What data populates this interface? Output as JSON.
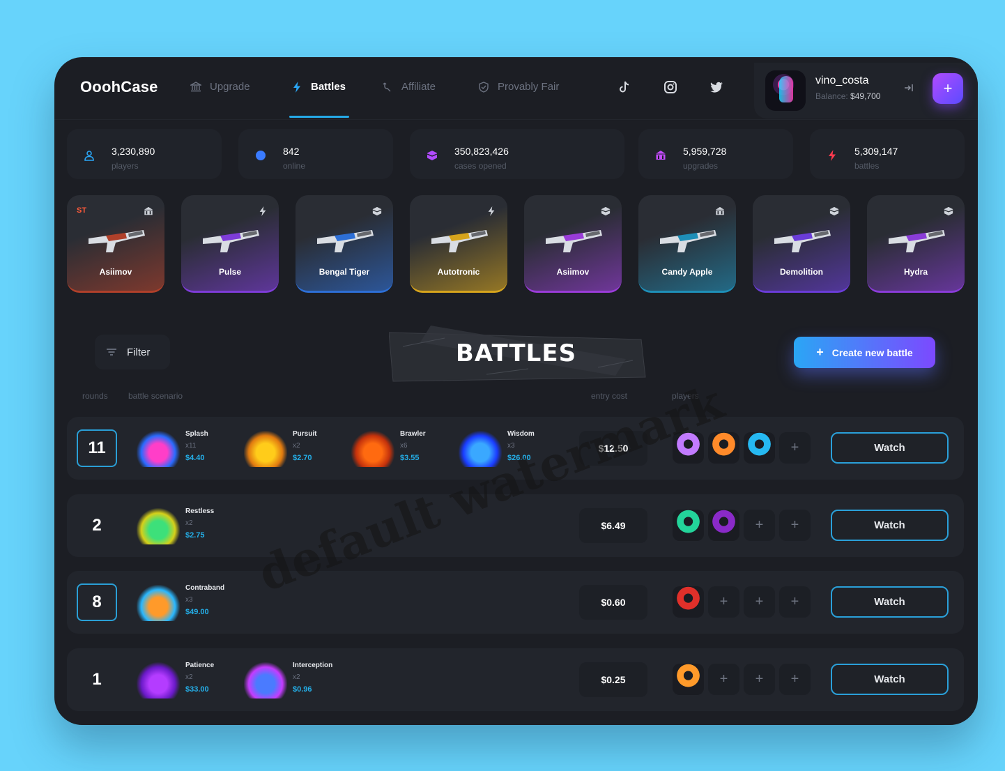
{
  "header": {
    "logo": "OoohCase",
    "nav": [
      {
        "label": "Upgrade",
        "icon": "bank-icon",
        "active": false
      },
      {
        "label": "Battles",
        "icon": "lightning-icon",
        "active": true
      },
      {
        "label": "Affiliate",
        "icon": "affiliate-icon",
        "active": false
      },
      {
        "label": "Provably Fair",
        "icon": "shield-check-icon",
        "active": false
      }
    ],
    "social": [
      "tiktok-icon",
      "instagram-icon",
      "twitter-icon"
    ],
    "user": {
      "name": "vino_costa",
      "balance_label": "Balance:",
      "balance_value": "$49,700"
    },
    "plus_button": "+"
  },
  "stats": [
    {
      "value": "3,230,890",
      "label": "players",
      "icon": "user-icon",
      "color": "#2aa6f5"
    },
    {
      "value": "842",
      "label": "online",
      "icon": "dot-icon",
      "color": "#3a7bff"
    },
    {
      "value": "350,823,426",
      "label": "cases opened",
      "icon": "case-icon",
      "color": "#b14bff"
    },
    {
      "value": "5,959,728",
      "label": "upgrades",
      "icon": "bank-icon",
      "color": "#c44bff"
    },
    {
      "value": "5,309,147",
      "label": "battles",
      "icon": "lightning-icon",
      "color": "#ff3a4e"
    }
  ],
  "skins": [
    {
      "name": "Asiimov",
      "badge": "ST",
      "icon": "bank-icon",
      "grad": [
        "#2a2d34",
        "#b0402a"
      ]
    },
    {
      "name": "Pulse",
      "badge": "",
      "icon": "lightning-icon",
      "grad": [
        "#2a2d34",
        "#7e3cd8"
      ]
    },
    {
      "name": "Bengal Tiger",
      "badge": "",
      "icon": "case-icon",
      "grad": [
        "#2a2d34",
        "#2d6fd6"
      ]
    },
    {
      "name": "Autotronic",
      "badge": "",
      "icon": "lightning-icon",
      "grad": [
        "#2a2d34",
        "#d6a41c"
      ]
    },
    {
      "name": "Asiimov",
      "badge": "",
      "icon": "case-icon",
      "grad": [
        "#2a2d34",
        "#9a3cd8"
      ]
    },
    {
      "name": "Candy Apple",
      "badge": "",
      "icon": "bank-icon",
      "grad": [
        "#2a2d34",
        "#1e8fb8"
      ]
    },
    {
      "name": "Demolition",
      "badge": "",
      "icon": "case-icon",
      "grad": [
        "#2a2d34",
        "#6a3cd8"
      ]
    },
    {
      "name": "Hydra",
      "badge": "",
      "icon": "case-icon",
      "grad": [
        "#2a2d34",
        "#8a3cd8"
      ]
    }
  ],
  "toolbar": {
    "filter_label": "Filter",
    "title": "BATTLES",
    "create_label": "Create new battle"
  },
  "columns": {
    "rounds": "rounds",
    "scenario": "battle scenario",
    "entry": "entry cost",
    "players": "players"
  },
  "battles": [
    {
      "rounds": "11",
      "boxed": true,
      "entry": "$12.50",
      "cases": [
        {
          "name": "Splash",
          "mult": "x11",
          "price": "$4.40",
          "colors": [
            "#ff3ec8",
            "#2a6bff"
          ]
        },
        {
          "name": "Pursuit",
          "mult": "x2",
          "price": "$2.70",
          "colors": [
            "#ffcc1a",
            "#e07a10"
          ]
        },
        {
          "name": "Brawler",
          "mult": "x6",
          "price": "$3.55",
          "colors": [
            "#ff6a10",
            "#c4320c"
          ]
        },
        {
          "name": "Wisdom",
          "mult": "x3",
          "price": "$26.00",
          "colors": [
            "#3aa8ff",
            "#1a3cff"
          ]
        }
      ],
      "players": [
        "#c27bff",
        "#ff8a2a",
        "#26b9f2"
      ],
      "empty_slots": 1,
      "watch": "Watch"
    },
    {
      "rounds": "2",
      "boxed": false,
      "entry": "$6.49",
      "cases": [
        {
          "name": "Restless",
          "mult": "x2",
          "price": "$2.75",
          "colors": [
            "#3de07a",
            "#d6d01a"
          ]
        }
      ],
      "players": [
        "#23d49a",
        "#8a2ac8"
      ],
      "empty_slots": 2,
      "watch": "Watch"
    },
    {
      "rounds": "8",
      "boxed": true,
      "entry": "$0.60",
      "cases": [
        {
          "name": "Contraband",
          "mult": "x3",
          "price": "$49.00",
          "colors": [
            "#ff9a2a",
            "#2ab8ff"
          ]
        }
      ],
      "players": [
        "#e0302a"
      ],
      "empty_slots": 3,
      "watch": "Watch"
    },
    {
      "rounds": "1",
      "boxed": false,
      "entry": "$0.25",
      "cases": [
        {
          "name": "Patience",
          "mult": "x2",
          "price": "$33.00",
          "colors": [
            "#b43cff",
            "#6a1ac8"
          ]
        },
        {
          "name": "Interception",
          "mult": "x2",
          "price": "$0.96",
          "colors": [
            "#4a7bff",
            "#c43cff"
          ]
        }
      ],
      "players": [
        "#ff9a2a"
      ],
      "empty_slots": 3,
      "watch": "Watch"
    }
  ],
  "watermark": "default watermark"
}
